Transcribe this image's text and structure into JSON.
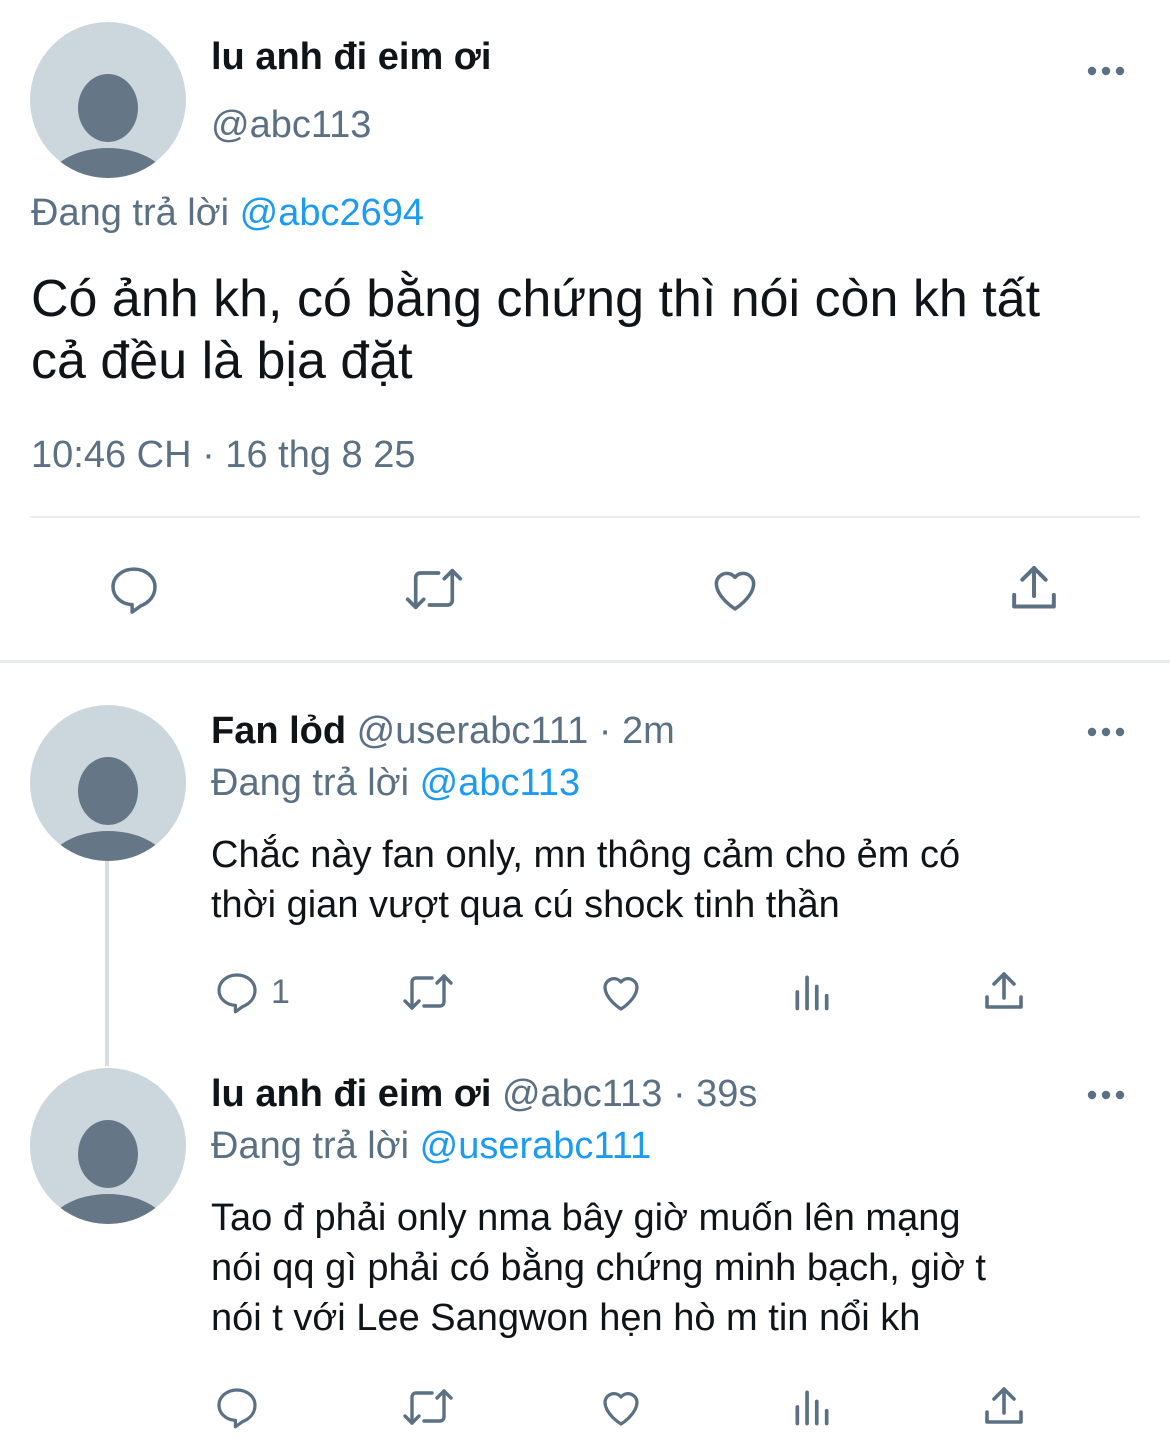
{
  "main_tweet": {
    "display_name": "lu anh đi eim ơi",
    "handle": "@abc113",
    "reply_prefix": "Đang trả lời",
    "reply_to": "@abc2694",
    "text_line1": "Có ảnh kh, có bằng chứng thì nói còn kh tất",
    "text_line2": "cả đều là bịa đặt",
    "timestamp": "10:46 CH · 16 thg 8 25"
  },
  "replies": [
    {
      "display_name": "Fan lỏd",
      "handle": "@userabc111",
      "time": "· 2m",
      "reply_prefix": "Đang trả lời",
      "reply_to": "@abc113",
      "text_line1": "Chắc này fan only, mn thông cảm cho ẻm có",
      "text_line2": "thời gian vượt qua cú shock tinh thần",
      "reply_count": "1"
    },
    {
      "display_name": "lu anh đi eim ơi",
      "handle": "@abc113",
      "time": "· 39s",
      "reply_prefix": "Đang trả lời",
      "reply_to": "@userabc111",
      "text_line1": "Tao đ phải only nma bây giờ muốn lên mạng",
      "text_line2": "nói qq gì phải có bằng chứng minh bạch, giờ t",
      "text_line3": "nói t với Lee Sangwon hẹn hò m tin nổi kh"
    }
  ],
  "icons": {
    "more": "more-horizontal-icon",
    "reply": "reply-icon",
    "retweet": "retweet-icon",
    "like": "like-icon",
    "views": "views-icon",
    "share": "share-icon"
  },
  "colors": {
    "link": "#1d9bf0",
    "muted": "#5b7083",
    "avatar_bg": "#ccd6dd",
    "avatar_fg": "#657786"
  }
}
